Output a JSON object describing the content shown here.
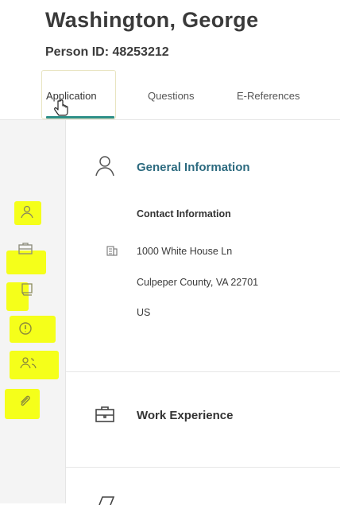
{
  "header": {
    "name": "Washington, George",
    "person_id": "Person ID: 48253212"
  },
  "tabs": [
    {
      "label": "Application",
      "active": true
    },
    {
      "label": "Questions",
      "active": false
    },
    {
      "label": "E-References",
      "active": false
    }
  ],
  "sidebar": {
    "items": [
      {
        "icon": "person-icon"
      },
      {
        "icon": "briefcase-icon"
      },
      {
        "icon": "book-icon"
      },
      {
        "icon": "info-icon"
      },
      {
        "icon": "people-icon"
      },
      {
        "icon": "paperclip-icon"
      }
    ],
    "highlight_color": "#f5ff1a"
  },
  "general_info": {
    "title": "General Information",
    "contact_label": "Contact Information",
    "address_line1": "1000 White House Ln",
    "address_line2": "Culpeper County, VA 22701",
    "country": "US"
  },
  "work_experience": {
    "title": "Work Experience"
  },
  "colors": {
    "accent": "#2e8f88",
    "link": "#2c6a7f"
  }
}
